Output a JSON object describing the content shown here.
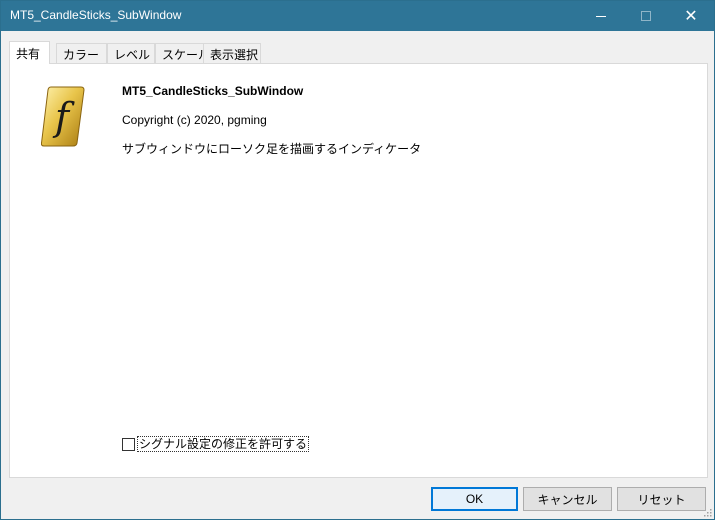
{
  "window": {
    "title": "MT5_CandleSticks_SubWindow",
    "minimize_icon": "minimize-icon",
    "maximize_icon": "maximize-icon",
    "close_glyph": "✕"
  },
  "tabs": [
    {
      "label": "共有",
      "active": true
    },
    {
      "label": "カラー",
      "active": false
    },
    {
      "label": "レベル",
      "active": false
    },
    {
      "label": "スケール",
      "active": false
    },
    {
      "label": "表示選択",
      "active": false
    }
  ],
  "info": {
    "icon": "function-f-icon",
    "icon_glyph": "f",
    "name": "MT5_CandleSticks_SubWindow",
    "copyright": "Copyright (c) 2020, pgming",
    "description": "サブウィンドウにローソク足を描画するインディケータ"
  },
  "signal": {
    "label": "シグナル設定の修正を許可する",
    "checked": false
  },
  "buttons": {
    "ok": "OK",
    "cancel": "キャンセル",
    "reset": "リセット"
  },
  "colors": {
    "titlebar": "#2e7597",
    "focus": "#0078d7",
    "icon_gold": "#d4a017"
  }
}
